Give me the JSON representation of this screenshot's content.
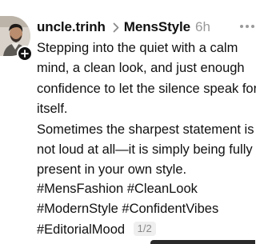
{
  "post": {
    "username": "uncle.trinh",
    "community": "MensStyle",
    "time": "6h",
    "body_lines": [
      "Stepping into the quiet with a calm",
      "mind, a clean look, and just enough",
      "confidence to let the silence speak for",
      "itself.",
      "Sometimes the sharpest statement is",
      "not loud at all—it is simply being fully",
      "present in your own style."
    ],
    "hashtags": [
      "#MensFashion",
      "#CleanLook",
      "#ModernStyle",
      "#ConfidentVibes",
      "#EditorialMood"
    ],
    "page_indicator": "1/2"
  },
  "icons": {
    "follow": "plus-icon",
    "separator": "chevron-right-icon",
    "menu": "more-horizontal-icon"
  },
  "colors": {
    "text": "#101010",
    "muted": "#999999",
    "badge_bg": "#111111"
  }
}
